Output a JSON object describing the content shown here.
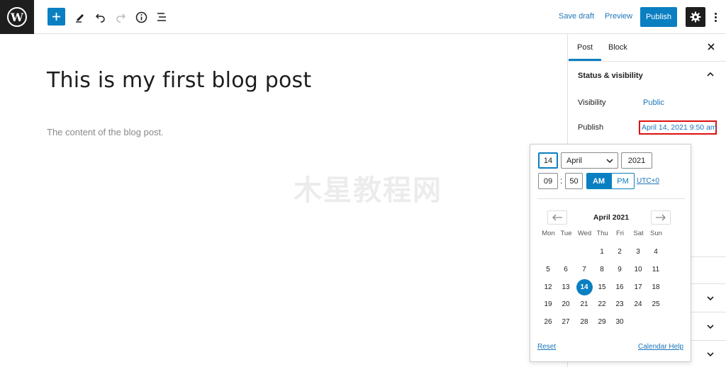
{
  "topbar": {
    "save_draft": "Save draft",
    "preview": "Preview",
    "publish": "Publish"
  },
  "editor": {
    "title": "This is my first blog post",
    "content": "The content of the blog post.",
    "watermark": "木星教程网"
  },
  "sidebar": {
    "tabs": [
      "Post",
      "Block"
    ],
    "section_title": "Status & visibility",
    "visibility_label": "Visibility",
    "visibility_value": "Public",
    "publish_label": "Publish",
    "publish_value": "April 14, 2021 9:50 am"
  },
  "datepicker": {
    "day": "14",
    "month": "April",
    "year": "2021",
    "hour": "09",
    "minute": "50",
    "am": "AM",
    "pm": "PM",
    "timezone": "UTC+0",
    "month_label": "April 2021",
    "weekdays": [
      "Mon",
      "Tue",
      "Wed",
      "Thu",
      "Fri",
      "Sat",
      "Sun"
    ],
    "weeks": [
      [
        "",
        "",
        "",
        "1",
        "2",
        "3",
        "4"
      ],
      [
        "5",
        "6",
        "7",
        "8",
        "9",
        "10",
        "11"
      ],
      [
        "12",
        "13",
        "14",
        "15",
        "16",
        "17",
        "18"
      ],
      [
        "19",
        "20",
        "21",
        "22",
        "23",
        "24",
        "25"
      ],
      [
        "26",
        "27",
        "28",
        "29",
        "30",
        "",
        ""
      ]
    ],
    "selected_day": "14",
    "reset": "Reset",
    "calendar_help": "Calendar Help"
  },
  "colors": {
    "accent": "#0a7fc2",
    "highlight_border": "#dd1111"
  }
}
